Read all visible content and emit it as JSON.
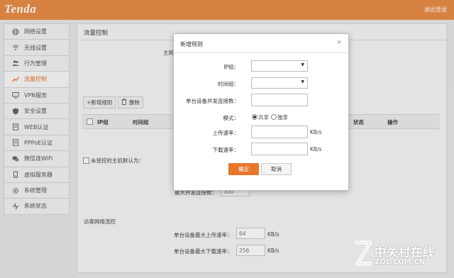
{
  "header": {
    "brand": "Tenda",
    "logout": "退出登录"
  },
  "colors": {
    "brand_orange": "#eb8e48",
    "active_orange": "#e8742c",
    "primary_button": "#e8762d"
  },
  "sidebar": {
    "items": [
      {
        "label": "网络设置",
        "icon": "globe-icon"
      },
      {
        "label": "无线设置",
        "icon": "wifi-icon"
      },
      {
        "label": "行为管理",
        "icon": "people-icon"
      },
      {
        "label": "流量控制",
        "icon": "chart-line-icon",
        "active": true
      },
      {
        "label": "VPN服务",
        "icon": "monitor-icon"
      },
      {
        "label": "安全设置",
        "icon": "shield-icon"
      },
      {
        "label": "WEB认证",
        "icon": "document-icon"
      },
      {
        "label": "PPPoE认证",
        "icon": "document-icon"
      },
      {
        "label": "微信连WiFi",
        "icon": "chat-icon"
      },
      {
        "label": "虚拟服务器",
        "icon": "server-icon"
      },
      {
        "label": "系统管理",
        "icon": "gear-icon"
      },
      {
        "label": "系统状态",
        "icon": "pulse-icon"
      }
    ]
  },
  "main": {
    "title": "流量控制",
    "partial_label": "主网",
    "add_rule_button": "+新增规则",
    "delete_button": "删除",
    "table_headers": {
      "ip_group": "IP组",
      "time_group": "时间组",
      "status": "状态",
      "action": "操作"
    },
    "uncontrolled_host_label": "未受控的主机默认为：",
    "max_connections_label": "最大并发连接数：",
    "max_connections_value": "300",
    "guest_section_title": "访客网络流控",
    "guest_upload_label": "单台设备最大上传速率：",
    "guest_upload_value": "64",
    "guest_download_label": "单台设备最大下载速率：",
    "guest_download_value": "256",
    "unit": "KB/s"
  },
  "dialog": {
    "title": "新增规则",
    "close": "×",
    "ip_group_label": "IP组：",
    "time_group_label": "时间组：",
    "max_conn_label": "单台设备并发连接数：",
    "mode_label": "模式：",
    "mode_shared": "共享",
    "mode_exclusive": "独享",
    "upload_label": "上传速率：",
    "download_label": "下载速率：",
    "unit": "KB/s",
    "ok_button": "确定",
    "cancel_button": "取消"
  },
  "watermark": {
    "line1": "中关村在线",
    "line2": "ZOL.COM.CN"
  }
}
